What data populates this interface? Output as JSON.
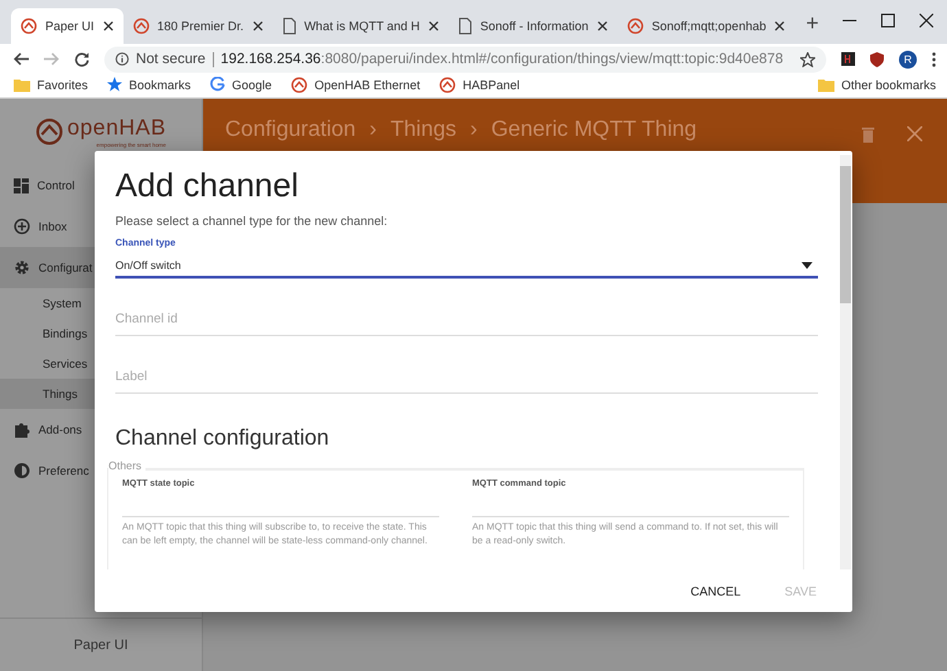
{
  "browser": {
    "tabs": [
      {
        "label": "Paper UI",
        "kind": "app",
        "selected": true
      },
      {
        "label": "180 Premier Dr.",
        "kind": "app",
        "selected": false
      },
      {
        "label": "What is MQTT and H",
        "kind": "page",
        "selected": false
      },
      {
        "label": "Sonoff - Information",
        "kind": "page",
        "selected": false
      },
      {
        "label": "Sonoff;mqtt;openhab",
        "kind": "app",
        "selected": false
      }
    ],
    "new_tab": "+",
    "address": {
      "security": "Not secure",
      "host": "192.168.254.36",
      "path": ":8080/paperui/index.html#/configuration/things/view/mqtt:topic:9d40e878"
    },
    "profile": "R",
    "bookmarks": [
      {
        "label": "Favorites",
        "kind": "folder"
      },
      {
        "label": "Bookmarks",
        "kind": "starred"
      },
      {
        "label": "Google",
        "kind": "search"
      },
      {
        "label": "OpenHAB Ethernet",
        "kind": "app"
      },
      {
        "label": "HABPanel",
        "kind": "app"
      }
    ],
    "other_bookmarks": "Other bookmarks"
  },
  "app": {
    "logo": {
      "name": "openHAB",
      "tagline": "empowering the smart home"
    },
    "sidebar": {
      "items": [
        {
          "label": "Control",
          "selected": false
        },
        {
          "label": "Inbox",
          "selected": false
        },
        {
          "label": "Configurat",
          "selected": true,
          "children": [
            {
              "label": "System",
              "selected": false
            },
            {
              "label": "Bindings",
              "selected": false
            },
            {
              "label": "Services",
              "selected": false
            },
            {
              "label": "Things",
              "selected": true
            }
          ]
        },
        {
          "label": "Add-ons",
          "selected": false
        },
        {
          "label": "Preferenc",
          "selected": false
        }
      ],
      "footer": "Paper UI"
    },
    "header": {
      "breadcrumb": [
        "Configuration",
        "Things",
        "Generic MQTT Thing"
      ],
      "separator": "›"
    }
  },
  "dialog": {
    "title": "Add channel",
    "description": "Please select a channel type for the new channel:",
    "fields": [
      {
        "kind": "select",
        "label": "Channel type",
        "value": "On/Off switch"
      },
      {
        "kind": "text",
        "placeholder": "Channel id"
      },
      {
        "kind": "text",
        "placeholder": "Label"
      }
    ],
    "section_title": "Channel configuration",
    "group": {
      "legend": "Others",
      "params": [
        {
          "label": "MQTT state topic",
          "description": "An MQTT topic that this thing will subscribe to, to receive the state. This can be left empty, the channel will be state-less command-only channel."
        },
        {
          "label": "MQTT command topic",
          "description": "An MQTT topic that this thing will send a command to. If not set, this will be a read-only switch."
        }
      ]
    },
    "buttons": [
      {
        "label": "CANCEL",
        "disabled": false
      },
      {
        "label": "SAVE",
        "disabled": true
      }
    ]
  }
}
